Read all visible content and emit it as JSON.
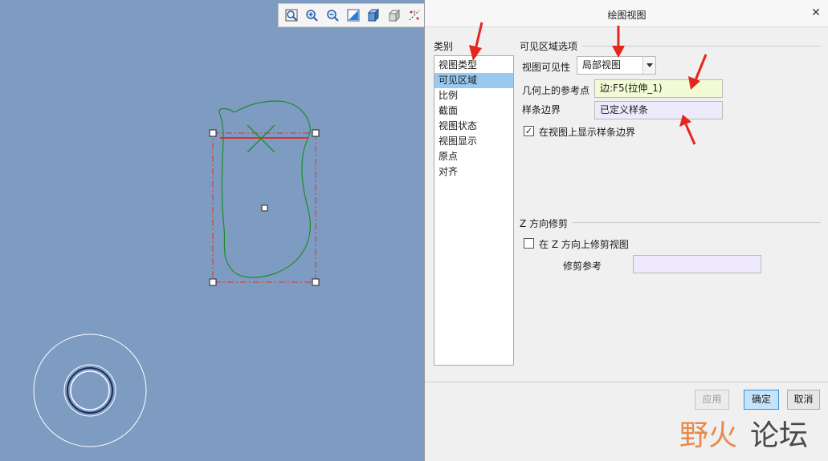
{
  "dialog": {
    "title": "绘图视图",
    "close_glyph": "✕",
    "category_header": "类别",
    "categories": [
      "视图类型",
      "可见区域",
      "比例",
      "截面",
      "视图状态",
      "视图显示",
      "原点",
      "对齐"
    ],
    "selected_category": "可见区域",
    "visible_area_section": {
      "header": "可见区域选项",
      "visibility_label": "视图可见性",
      "visibility_value": "局部视图",
      "reference_point_label": "几何上的参考点",
      "reference_point_value": "边:F5(拉伸_1)",
      "spline_boundary_label": "样条边界",
      "spline_boundary_value": "已定义样条",
      "show_spline_checkbox_label": "在视图上显示样条边界",
      "show_spline_checked": true
    },
    "z_clip_section": {
      "header": "Z 方向修剪",
      "clip_checkbox_label": "在 Z 方向上修剪视图",
      "clip_checked": false,
      "clip_reference_label": "修剪参考",
      "clip_reference_value": ""
    },
    "buttons": {
      "apply": "应用",
      "ok": "确定",
      "cancel": "取消"
    }
  },
  "toolbar": {
    "icons": [
      "zoom-fit-icon",
      "zoom-in-icon",
      "zoom-out-icon",
      "repaint-icon",
      "shaded-view-icon",
      "hidden-line-icon",
      "datum-display-icon"
    ]
  },
  "watermark": {
    "part1": "野火",
    "part2": "论坛"
  },
  "colors": {
    "canvas_bg": "#7e9cc1",
    "spline_green": "#1e8c2a",
    "boundary_red": "#e0302a",
    "selection_blue": "#99c9ef",
    "arrow_red": "#e4261c"
  }
}
